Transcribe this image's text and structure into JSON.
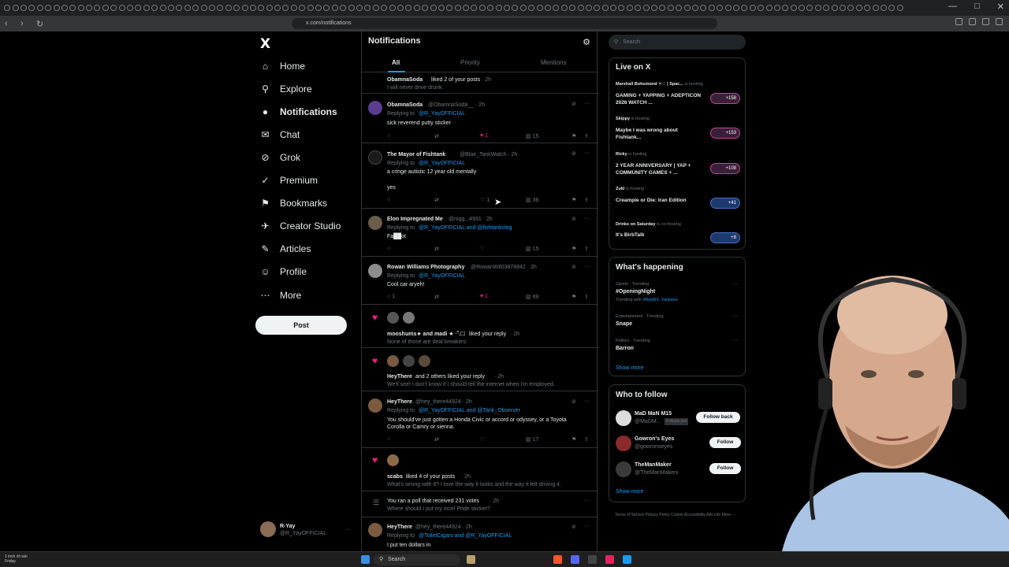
{
  "browser": {
    "url": "x.com/notifications",
    "window_controls": [
      "—",
      "□",
      "✕"
    ]
  },
  "sidebar": {
    "logo": "X",
    "items": [
      {
        "label": "Home",
        "icon": "home-icon",
        "glyph": "⌂"
      },
      {
        "label": "Explore",
        "icon": "search-icon",
        "glyph": "⚲"
      },
      {
        "label": "Notifications",
        "icon": "bell-icon",
        "glyph": "🔔︎"
      },
      {
        "label": "Chat",
        "icon": "mail-icon",
        "glyph": "✉"
      },
      {
        "label": "Grok",
        "icon": "grok-icon",
        "glyph": "⊘"
      },
      {
        "label": "Premium",
        "icon": "verified-icon",
        "glyph": "✓"
      },
      {
        "label": "Bookmarks",
        "icon": "bookmark-icon",
        "glyph": "⚑"
      },
      {
        "label": "Creator Studio",
        "icon": "rocket-icon",
        "glyph": "✈"
      },
      {
        "label": "Articles",
        "icon": "article-icon",
        "glyph": "✎"
      },
      {
        "label": "Profile",
        "icon": "person-icon",
        "glyph": "☺"
      },
      {
        "label": "More",
        "icon": "more-circle-icon",
        "glyph": "⋯"
      }
    ],
    "post_button": "Post",
    "account": {
      "name": "R-Yay",
      "handle": "@R_YayOFFICIAL"
    }
  },
  "main": {
    "title": "Notifications",
    "tabs": [
      "All",
      "Priority",
      "Mentions"
    ],
    "notifications": {
      "n1": {
        "user": "ObamnaSoda",
        "text": "liked 2 of your posts",
        "time": "· 2h",
        "sub": "I will never drive drunk."
      },
      "n2": {
        "user": "ObamnaSoda",
        "handle": "@ObamnaSoda__ · 2h",
        "reply": "Replying to",
        "reply_to": "@R_YayOFFICIAL",
        "text": "sick reverend putty sticker",
        "likes": "1",
        "views": "15"
      },
      "n3": {
        "user": "The Mayor of Fishtank",
        "handle": "@Blair_TankWatch · 2h",
        "reply": "Replying to",
        "reply_to": "@R_YayOFFICIAL",
        "text": "a cringe autistic 12 year old mentally",
        "text2": "yes",
        "likes": "1",
        "views": "38"
      },
      "n4": {
        "user": "Elon Impregnated Me",
        "handle": "@nigg...4931 · 2h",
        "reply": "Replying to",
        "reply_to": "@R_YayOFFICIAL and @fishtankcleg",
        "text": "Fa██ot",
        "views": "15"
      },
      "n5": {
        "user": "Rowan Williams Photography",
        "handle": "@RowanWil03878842 · 2h",
        "reply": "Replying to",
        "reply_to": "@R_YayOFFICIAL",
        "text": "Cool car aryeh!",
        "replies": "1",
        "likes": "1",
        "views": "69"
      },
      "n6": {
        "user": "mooshums★ and madi ★ ·˚.☐",
        "text": "liked your reply",
        "time": "· 2h",
        "sub": "None of those are deal breakers."
      },
      "n7": {
        "user": "HeyThere",
        "text": "and 2 others liked your reply",
        "time": "· 2h",
        "sub": "We'll see! I don't know if I should tell the internet when I'm employed."
      },
      "n8": {
        "user": "HeyThere",
        "handle": "@hey_there44924 · 2h",
        "reply": "Replying to",
        "reply_to": "@R_YayOFFICIAL and @Tank_Observer",
        "text": "You should've just gotten a Honda Civic or accord or odyssey, or a Toyota",
        "text2": "Corolla or Camry or sienna.",
        "views": "17"
      },
      "n9": {
        "user": "scabs",
        "text": "liked 4 of your posts",
        "time": "· 2h",
        "sub": "What's wrong with it? I love the way it looks and the way it felt driving it."
      },
      "n10": {
        "text": "You ran a poll that received 231 votes",
        "time": "· 2h",
        "sub": "Where should I put my incel Pride sticker?"
      },
      "n11": {
        "user": "HeyThere",
        "handle": "@hey_there44924 · 2h",
        "reply": "Replying to",
        "reply_to": "@ToiletCigars and @R_YayOFFICIAL",
        "text": "I put ten dollars in"
      }
    }
  },
  "right": {
    "search_placeholder": "Search",
    "live": {
      "title": "Live on X",
      "items": [
        {
          "host": "Marshall Bohemond ✕♡ | Spac...",
          "status": "is hosting",
          "title": "GAMING + YAPPING + ADEPTICON 2026 WATCH ...",
          "count": "+158"
        },
        {
          "host": "Skippy",
          "status": "is hosting",
          "title": "Maybe I was wrong about Fishtank...",
          "count": "+153"
        },
        {
          "host": "Ricky",
          "status": "is hosting",
          "title": "2 YEAR ANNIVERSARY | YAP + COMMUNITY GAMES + ...",
          "count": "+108"
        },
        {
          "host": "Zukl",
          "status": "is hosting",
          "title": "Creampie or Die: Iran Edition",
          "count": "+41"
        },
        {
          "host": "Drinks on Saturday",
          "status": "is co-hosting",
          "title": "It's BirbTalk",
          "count": "+8"
        }
      ]
    },
    "happening": {
      "title": "What's happening",
      "items": [
        {
          "meta": "Sports · Trending",
          "topic": "#OpeningNight",
          "sub_pre": "Trending with",
          "sub": "#RepBX, Yankees"
        },
        {
          "meta": "Entertainment · Trending",
          "topic": "Snape"
        },
        {
          "meta": "Politics · Trending",
          "topic": "Barron"
        }
      ],
      "show_more": "Show more"
    },
    "who_to_follow": {
      "title": "Who to follow",
      "items": [
        {
          "name": "MaD MaN M15",
          "handle": "@MaDM...",
          "badge": "Follows you",
          "button": "Follow back"
        },
        {
          "name": "Gowron's Eyes",
          "handle": "@gowronseyes",
          "button": "Follow"
        },
        {
          "name": "TheManMaker",
          "handle": "@TheManMakerx",
          "button": "Follow"
        }
      ],
      "show_more": "Show more"
    },
    "footer": "Terms of Service   Privacy Policy   Cookie   Accessibility   Ads info   More ···"
  },
  "taskbar": {
    "weather_line1": "1 inch of rain",
    "weather_line2": "Friday",
    "search": "Search"
  }
}
